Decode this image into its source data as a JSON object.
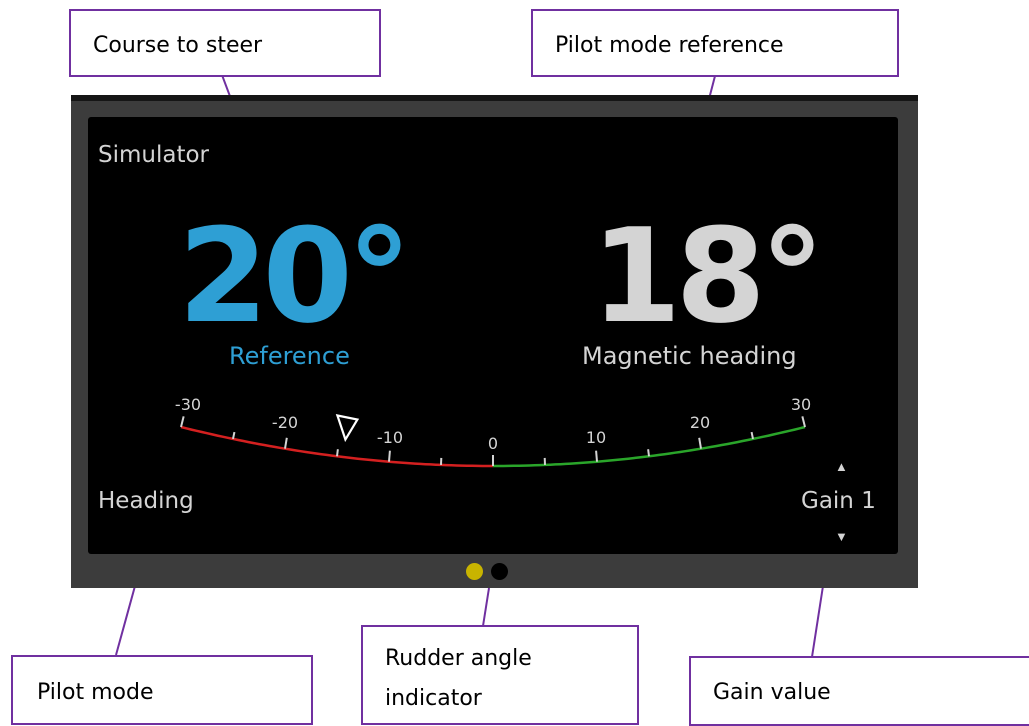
{
  "callouts": {
    "course_to_steer": "Course to steer",
    "pilot_mode_reference": "Pilot mode reference",
    "pilot_mode": "Pilot mode",
    "rudder_angle_indicator_line1": "Rudder angle",
    "rudder_angle_indicator_line2": "indicator",
    "gain_value": "Gain value"
  },
  "display": {
    "source": "Simulator",
    "reference_value": "20°",
    "reference_label": "Reference",
    "heading_value": "18°",
    "heading_label": "Magnetic heading",
    "pilot_mode": "Heading",
    "gain": "Gain 1",
    "gain_up_icon": "▲",
    "gain_down_icon": "▼"
  },
  "rudder": {
    "min": -30,
    "max": 30,
    "major_step": 10,
    "minor_step": 5,
    "tick_labels": [
      "-30",
      "-20",
      "-10",
      "0",
      "10",
      "20",
      "30"
    ],
    "pointer_value": -14,
    "port_color": "#d42020",
    "starboard_color": "#2aa52a"
  },
  "colors": {
    "accent": "#2e9fd4",
    "primary_text": "#d4d4d4",
    "callout_border": "#7030a0",
    "active_page_dot": "#c8b400",
    "inactive_page_dot": "#000000"
  },
  "pages": {
    "count": 2,
    "active_index": 0
  }
}
